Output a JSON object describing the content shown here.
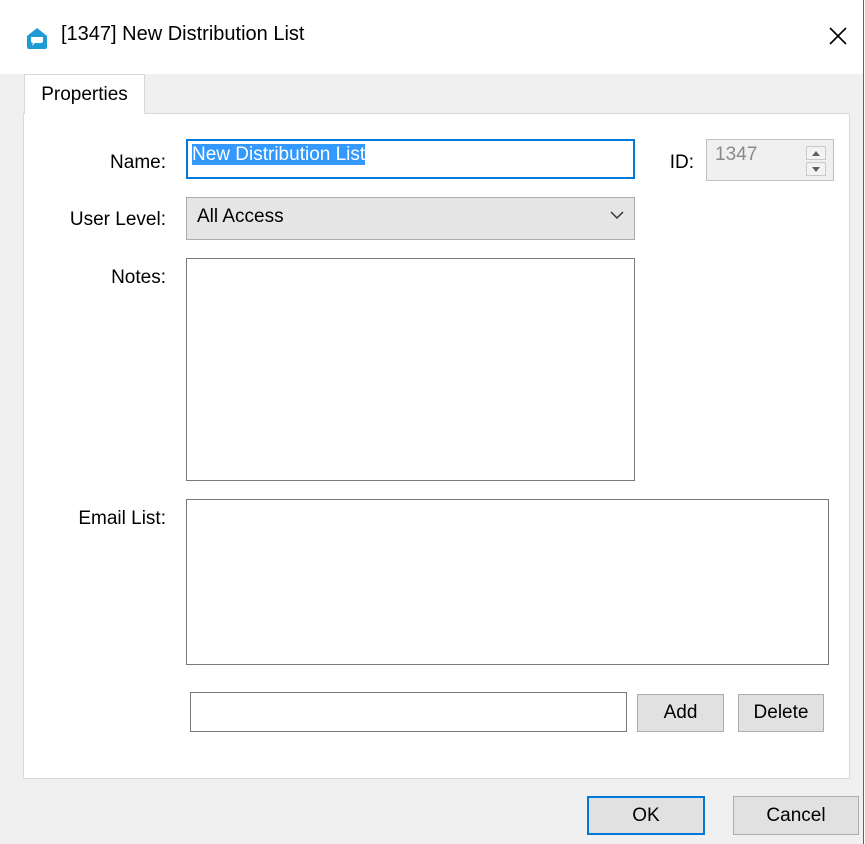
{
  "window": {
    "title": "[1347] New Distribution List"
  },
  "icons": {
    "app": "distribution-list-icon",
    "close": "close-icon",
    "dropdown": "chevron-down-icon",
    "spin_up": "spin-up-icon",
    "spin_down": "spin-down-icon"
  },
  "tabs": [
    {
      "label": "Properties",
      "selected": true
    }
  ],
  "form": {
    "name_label": "Name:",
    "name_value": "New Distribution List",
    "id_label": "ID:",
    "id_value": "1347",
    "user_level_label": "User Level:",
    "user_level_value": "All Access",
    "notes_label": "Notes:",
    "notes_value": "",
    "email_list_label": "Email List:",
    "email_items": [],
    "new_email_value": "",
    "add_label": "Add",
    "delete_label": "Delete"
  },
  "footer": {
    "ok_label": "OK",
    "cancel_label": "Cancel"
  },
  "colors": {
    "accent": "#0078d7",
    "selection": "#3399ff",
    "window_bg": "#f0f0f0",
    "app_icon": "#1f9bd3"
  }
}
